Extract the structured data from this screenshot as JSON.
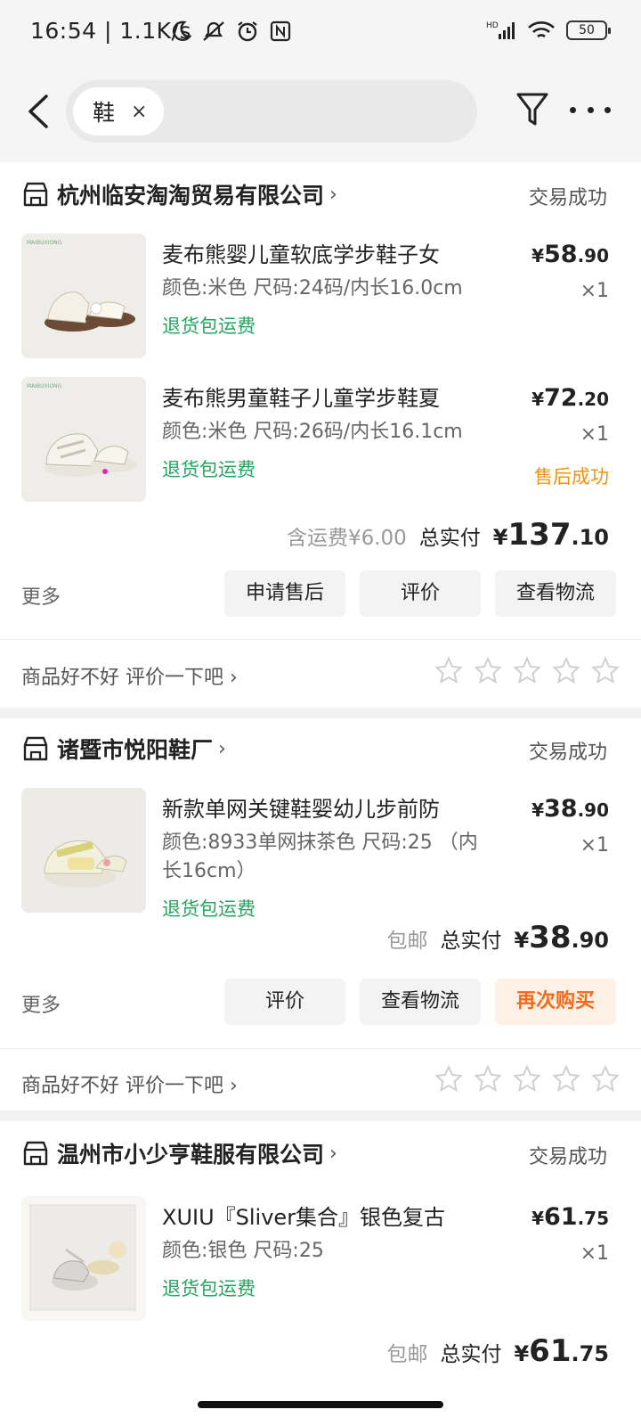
{
  "status_bar": {
    "time": "16:54",
    "speed": "| 1.1K/s",
    "battery": "50"
  },
  "search": {
    "chip_text": "鞋",
    "chip_clear": "×"
  },
  "orders": [
    {
      "store": "杭州临安淘淘贸易有限公司",
      "status": "交易成功",
      "items": [
        {
          "title": "麦布熊婴儿童软底学步鞋子女",
          "spec": "颜色:米色 尺码:24码/内长16.0cm",
          "tag": "退货包运费",
          "price_cur": "¥",
          "price_int": "58",
          "price_dec": ".90",
          "qty": "×1"
        },
        {
          "title": "麦布熊男童鞋子儿童学步鞋夏",
          "spec": "颜色:米色 尺码:26码/内长16.1cm",
          "tag": "退货包运费",
          "price_cur": "¥",
          "price_int": "72",
          "price_dec": ".20",
          "qty": "×1",
          "after_sale": "售后成功"
        }
      ],
      "shipping_note": "含运费¥6.00",
      "total_label": "总实付",
      "total_cur": "¥",
      "total_int": "137",
      "total_dec": ".10",
      "more": "更多",
      "buttons": [
        "申请售后",
        "评价",
        "查看物流"
      ],
      "review_prompt": "商品好不好 评价一下吧 ›"
    },
    {
      "store": "诸暨市悦阳鞋厂",
      "status": "交易成功",
      "items": [
        {
          "title": "新款单网关键鞋婴幼儿步前防",
          "spec": "颜色:8933单网抹茶色 尺码:25 （内长16cm）",
          "tag": "退货包运费",
          "price_cur": "¥",
          "price_int": "38",
          "price_dec": ".90",
          "qty": "×1"
        }
      ],
      "shipping_note": "包邮",
      "total_label": "总实付",
      "total_cur": "¥",
      "total_int": "38",
      "total_dec": ".90",
      "more": "更多",
      "buttons": [
        "评价",
        "查看物流",
        "再次购买"
      ],
      "review_prompt": "商品好不好 评价一下吧 ›"
    },
    {
      "store": "温州市小少亨鞋服有限公司",
      "status": "交易成功",
      "items": [
        {
          "title": "XUIU『Sliver集合』银色复古",
          "spec": "颜色:银色 尺码:25",
          "tag": "退货包运费",
          "price_cur": "¥",
          "price_int": "61",
          "price_dec": ".75",
          "qty": "×1"
        }
      ],
      "shipping_note": "包邮",
      "total_label": "总实付",
      "total_cur": "¥",
      "total_int": "61",
      "total_dec": ".75"
    }
  ],
  "colors": {
    "green_tag": "#27a35f",
    "after_sale_orange": "#f0930f",
    "buy_again_orange": "#f36a1a"
  },
  "icons": [
    "back-arrow-icon",
    "filter-icon",
    "more-dots-icon",
    "store-icon",
    "star-icon",
    "chevron-right-icon"
  ]
}
